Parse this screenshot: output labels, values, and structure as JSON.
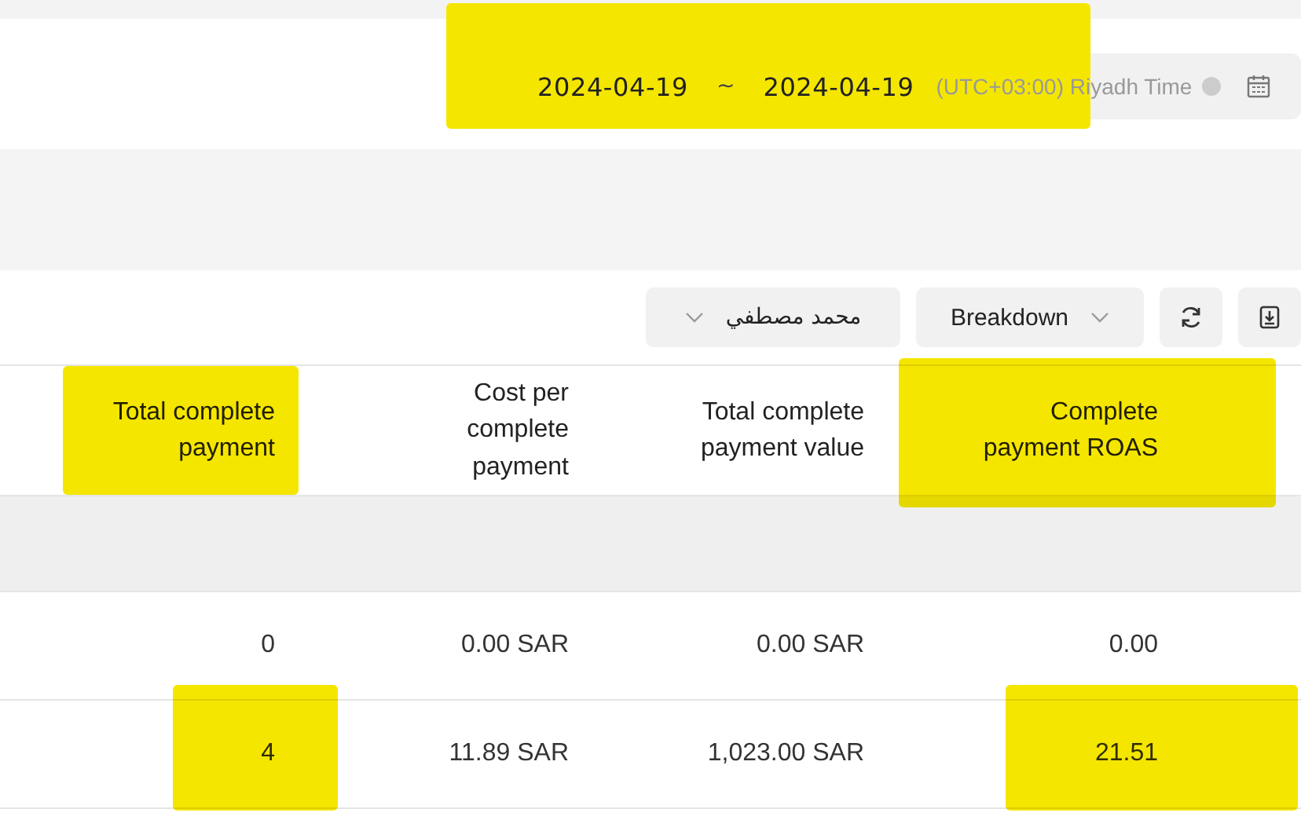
{
  "date_range": {
    "start": "2024-04-19",
    "separator": "~",
    "end": "2024-04-19",
    "timezone": "(UTC+03:00) Riyadh Time",
    "highlighted": true
  },
  "toolbar": {
    "account_filter": "محمد مصطفي",
    "breakdown": "Breakdown"
  },
  "table": {
    "columns": [
      {
        "label": "Total complete payment",
        "highlighted": true
      },
      {
        "label": "Cost per complete payment",
        "highlighted": false
      },
      {
        "label": "Total complete payment value",
        "highlighted": false
      },
      {
        "label": "Complete payment ROAS",
        "highlighted": true
      }
    ],
    "rows": [
      {
        "cells": [
          {
            "text": "0",
            "highlighted": false
          },
          {
            "text": "0.00 SAR",
            "highlighted": false
          },
          {
            "text": "0.00 SAR",
            "highlighted": false
          },
          {
            "text": "0.00",
            "highlighted": false
          }
        ]
      },
      {
        "cells": [
          {
            "text": "4",
            "highlighted": true
          },
          {
            "text": "11.89 SAR",
            "highlighted": false
          },
          {
            "text": "1,023.00 SAR",
            "highlighted": false
          },
          {
            "text": "21.51",
            "highlighted": true
          }
        ]
      }
    ]
  }
}
